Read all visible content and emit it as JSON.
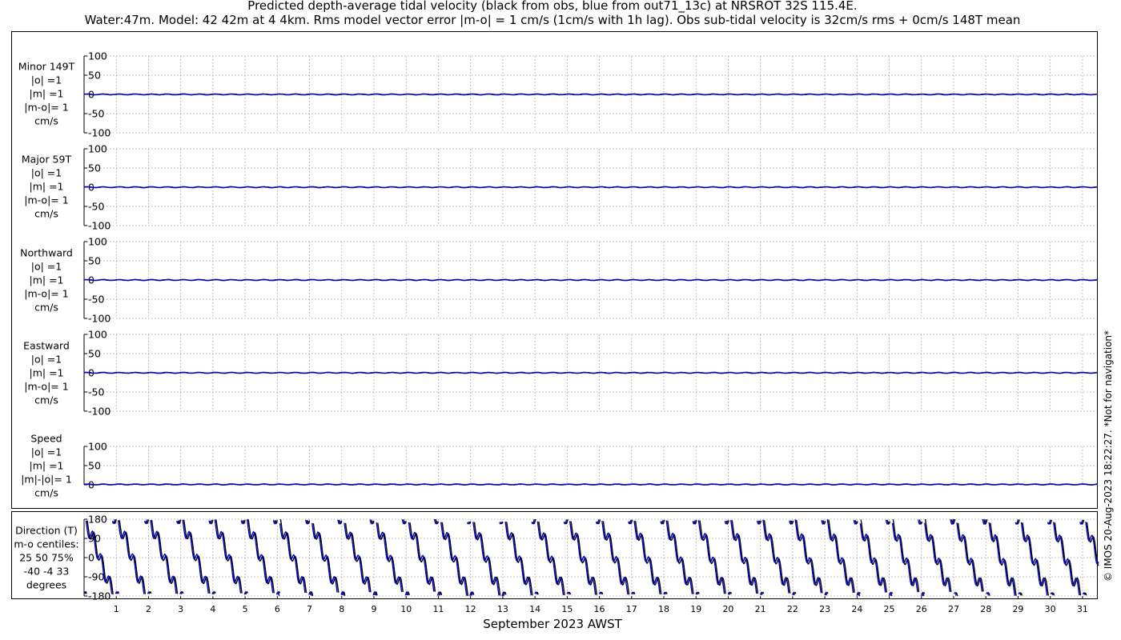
{
  "title_line1": "Predicted depth-average tidal velocity (black from obs, blue from out71_13c) at NRSROT 32S 115.4E.",
  "title_line2": "Water:47m. Model: 42 42m at 4 4km. Rms model vector error |m-o| = 1 cm/s (1cm/s with 1h lag). Obs sub-tidal velocity is 32cm/s rms + 0cm/s 148T mean",
  "side_note": "© IMOS 20-Aug-2023 18:22:27. *Not for navigation*",
  "colors": {
    "obs": "#000000",
    "model": "#0000cc"
  },
  "chart_data": [
    {
      "type": "line",
      "id": "minor",
      "label_lines": [
        "Minor 149T",
        "|o| =1",
        "|m| =1",
        "|m-o|= 1",
        "cm/s"
      ],
      "ylim": [
        -100,
        100
      ],
      "yticks": [
        100,
        50,
        0,
        -50,
        -100
      ],
      "series": [
        {
          "style": "obs",
          "amplitude": 1,
          "mean": 0
        },
        {
          "style": "model",
          "amplitude": 1,
          "mean": 0
        }
      ]
    },
    {
      "type": "line",
      "id": "major",
      "label_lines": [
        "Major 59T",
        "|o| =1",
        "|m| =1",
        "|m-o|= 1",
        "cm/s"
      ],
      "ylim": [
        -100,
        100
      ],
      "yticks": [
        100,
        50,
        0,
        -50,
        -100
      ],
      "series": [
        {
          "style": "obs",
          "amplitude": 1,
          "mean": 0
        },
        {
          "style": "model",
          "amplitude": 1,
          "mean": 0
        }
      ]
    },
    {
      "type": "line",
      "id": "north",
      "label_lines": [
        "Northward",
        "|o| =1",
        "|m| =1",
        "|m-o|= 1",
        "cm/s"
      ],
      "ylim": [
        -100,
        100
      ],
      "yticks": [
        100,
        50,
        0,
        -50,
        -100
      ],
      "series": [
        {
          "style": "obs",
          "amplitude": 1,
          "mean": 0
        },
        {
          "style": "model",
          "amplitude": 1,
          "mean": 0
        }
      ]
    },
    {
      "type": "line",
      "id": "east",
      "label_lines": [
        "Eastward",
        "|o| =1",
        "|m| =1",
        "|m-o|= 1",
        "cm/s"
      ],
      "ylim": [
        -100,
        100
      ],
      "yticks": [
        100,
        50,
        0,
        -50,
        -100
      ],
      "series": [
        {
          "style": "obs",
          "amplitude": 1,
          "mean": 0
        },
        {
          "style": "model",
          "amplitude": 1,
          "mean": 0
        }
      ]
    },
    {
      "type": "line",
      "id": "speed",
      "label_lines": [
        "Speed",
        "|o| =1",
        "|m| =1",
        "|m|-|o|= 1",
        "cm/s"
      ],
      "ylim": [
        0,
        100
      ],
      "yticks": [
        100,
        50,
        0
      ],
      "series": [
        {
          "style": "obs",
          "amplitude": 1,
          "mean": 1
        },
        {
          "style": "model",
          "amplitude": 1,
          "mean": 1
        }
      ]
    },
    {
      "type": "line",
      "id": "direction",
      "label_lines": [
        "Direction (T)",
        "m-o centiles:",
        "25  50  75%",
        "-40  -4  33",
        "degrees"
      ],
      "ylim": [
        -180,
        180
      ],
      "yticks": [
        180,
        90,
        0,
        -90,
        -180
      ],
      "series": [
        {
          "style": "obs",
          "wrapped": true
        },
        {
          "style": "model",
          "wrapped": true
        }
      ]
    }
  ],
  "x_axis": {
    "label": "September 2023 AWST",
    "range_days": [
      0,
      31.5
    ],
    "ticks": [
      "1",
      "2",
      "3",
      "4",
      "5",
      "6",
      "7",
      "8",
      "9",
      "10",
      "11",
      "12",
      "13",
      "14",
      "15",
      "16",
      "17",
      "18",
      "19",
      "20",
      "21",
      "22",
      "23",
      "24",
      "25",
      "26",
      "27",
      "28",
      "29",
      "30",
      "31"
    ],
    "grid": true
  }
}
